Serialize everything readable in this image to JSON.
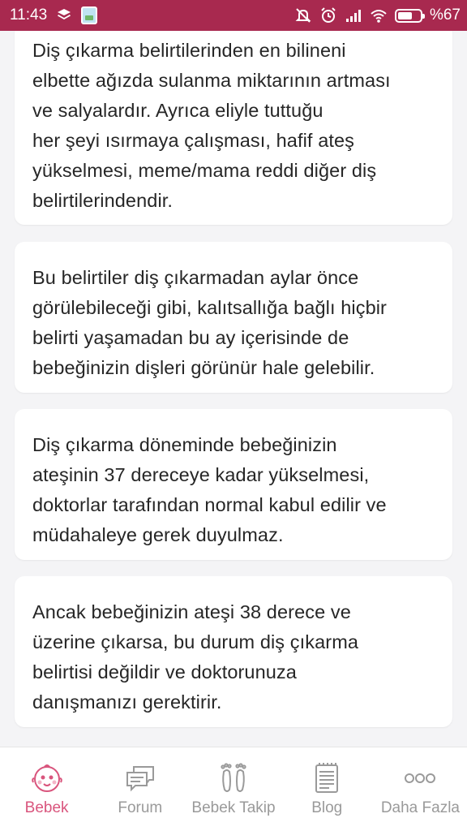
{
  "status_bar": {
    "time": "11:43",
    "battery_text": "%67",
    "battery_level": 0.67,
    "icons": [
      "stack-icon",
      "app-notification-icon",
      "mute-icon",
      "alarm-icon",
      "signal-icon",
      "wifi-icon",
      "battery-icon"
    ]
  },
  "cards": [
    {
      "lines": [
        "Diş çıkarma belirtilerinden en bilineni",
        "elbette ağızda sulanma miktarının artması",
        "ve salyalardır. Ayrıca eliyle tuttuğu",
        "her şeyi ısırmaya çalışması, hafif ateş",
        "yükselmesi, meme/mama reddi diğer diş",
        "belirtilerindendir."
      ]
    },
    {
      "lines": [
        "Bu belirtiler diş çıkarmadan aylar önce",
        "görülebileceği gibi, kalıtsallığa bağlı hiçbir",
        "belirti yaşamadan bu ay içerisinde de",
        "bebeğinizin dişleri görünür hale gelebilir."
      ]
    },
    {
      "lines": [
        "Diş çıkarma döneminde bebeğinizin",
        "ateşinin 37 dereceye kadar yükselmesi,",
        "doktorlar tarafından normal kabul edilir ve",
        "müdahaleye gerek duyulmaz."
      ]
    },
    {
      "lines": [
        "Ancak bebeğinizin ateşi 38 derece ve",
        "üzerine çıkarsa, bu durum diş çıkarma",
        "belirtisi değildir ve doktorunuza",
        "danışmanızı gerektirir."
      ]
    }
  ],
  "bottom_nav": {
    "items": [
      {
        "label": "Bebek",
        "icon": "baby-face-icon",
        "active": true
      },
      {
        "label": "Forum",
        "icon": "chat-bubbles-icon",
        "active": false
      },
      {
        "label": "Bebek Takip",
        "icon": "footprints-icon",
        "active": false
      },
      {
        "label": "Blog",
        "icon": "notepad-icon",
        "active": false
      },
      {
        "label": "Daha Fazla",
        "icon": "more-dots-icon",
        "active": false
      }
    ]
  },
  "colors": {
    "status_bar": "#a8294f",
    "accent": "#d9557d",
    "inactive": "#9a9a9a",
    "background": "#f4f4f6"
  }
}
